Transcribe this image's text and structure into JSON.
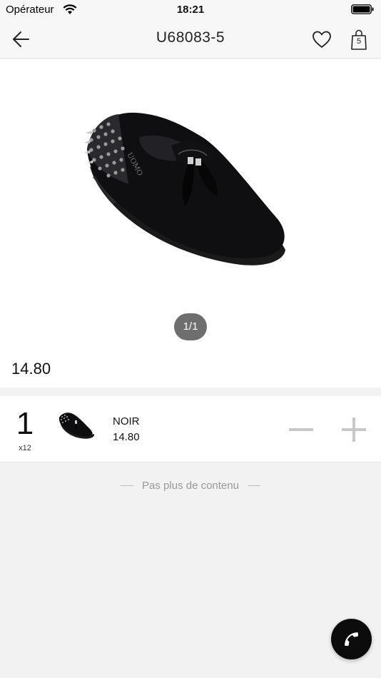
{
  "status_bar": {
    "carrier": "Opérateur",
    "time": "18:21"
  },
  "nav": {
    "title": "U68083-5",
    "cart_count": "5"
  },
  "product": {
    "image_icon": "shoe-loafer-image",
    "pager": "1/1",
    "price": "14.80"
  },
  "variant": {
    "quantity": "1",
    "pack": "x12",
    "color": "NOIR",
    "price": "14.80"
  },
  "footer": {
    "end_text": "Pas plus de contenu"
  },
  "colors": {
    "page_bg": "#f2f2f2",
    "card_bg": "#ffffff",
    "call_button": "#0c0c0c",
    "pager_bg": "#6e6e6e",
    "stepper": "#c8c8c8"
  }
}
